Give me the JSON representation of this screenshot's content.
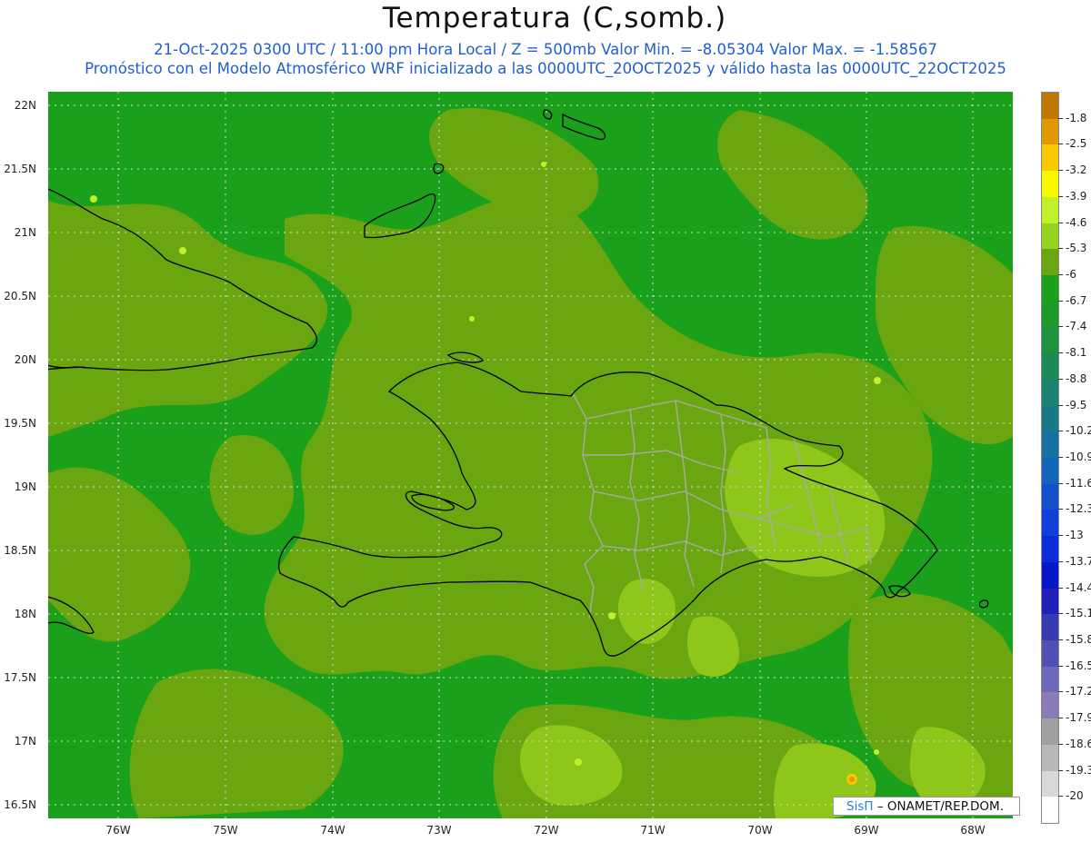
{
  "header": {
    "title": "Temperatura (C,somb.)",
    "subtitle_line1": "21-Oct-2025  0300 UTC / 11:00 pm Hora Local / Z = 500mb  Valor Min. = -8.05304  Valor Max. = -1.58567",
    "subtitle_line2": "Pronóstico con el Modelo Atmosférico WRF inicializado a las 0000UTC_20OCT2025 y válido hasta las  0000UTC_22OCT2025"
  },
  "map": {
    "lat_ticks": [
      "22N",
      "21.5N",
      "21N",
      "20.5N",
      "20N",
      "19.5N",
      "19N",
      "18.5N",
      "18N",
      "17.5N",
      "17N",
      "16.5N"
    ],
    "lon_ticks": [
      "76W",
      "75W",
      "74W",
      "73W",
      "72W",
      "71W",
      "70W",
      "69W",
      "68W"
    ],
    "colors": {
      "field_dark": "#1aa01a",
      "field_mid": "#6aa610",
      "field_light": "#8ec61a",
      "field_bright": "#b5e830",
      "coast": "#000000",
      "borders": "#a8a8a8",
      "grid": "#d8d8d8"
    }
  },
  "colorbar": {
    "levels": [
      {
        "label": "-1.8",
        "color": "#c07800"
      },
      {
        "label": "-2.5",
        "color": "#e09800"
      },
      {
        "label": "-3.2",
        "color": "#f8c800"
      },
      {
        "label": "-3.9",
        "color": "#f8f800"
      },
      {
        "label": "-4.6",
        "color": "#c0f028"
      },
      {
        "label": "-5.3",
        "color": "#96d222"
      },
      {
        "label": "-6",
        "color": "#6aa610"
      },
      {
        "label": "-6.7",
        "color": "#1aa01a"
      },
      {
        "label": "-7.4",
        "color": "#1d9a2a"
      },
      {
        "label": "-8.1",
        "color": "#1e923c"
      },
      {
        "label": "-8.8",
        "color": "#1c8a56"
      },
      {
        "label": "-9.5",
        "color": "#1a8270"
      },
      {
        "label": "-10.2",
        "color": "#187888"
      },
      {
        "label": "-10.9",
        "color": "#1670a0"
      },
      {
        "label": "-11.6",
        "color": "#1464bc"
      },
      {
        "label": "-12.3",
        "color": "#1250cc"
      },
      {
        "label": "-13",
        "color": "#1040d8"
      },
      {
        "label": "-13.7",
        "color": "#0c2cd8"
      },
      {
        "label": "-14.4",
        "color": "#0818c8"
      },
      {
        "label": "-15.1",
        "color": "#2020b8"
      },
      {
        "label": "-15.8",
        "color": "#3838b0"
      },
      {
        "label": "-16.5",
        "color": "#5050b0"
      },
      {
        "label": "-17.2",
        "color": "#6a6ab8"
      },
      {
        "label": "-17.9",
        "color": "#8a7ab8"
      },
      {
        "label": "-18.6",
        "color": "#a0a0a0"
      },
      {
        "label": "-19.3",
        "color": "#b8b8b8"
      },
      {
        "label": "-20",
        "color": "#d8d8d8"
      },
      {
        "label": "",
        "color": "#ffffff"
      }
    ]
  },
  "credit": {
    "sis": "SisΠ",
    "org": "– ONAMET/REP.DOM."
  }
}
